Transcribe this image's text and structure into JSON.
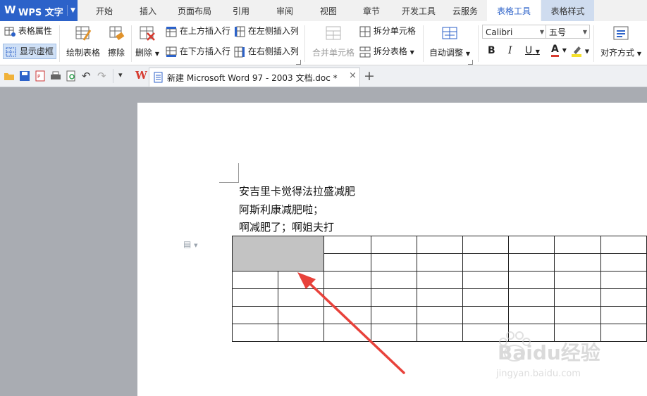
{
  "app": {
    "name": "WPS 文字"
  },
  "menu_tabs": [
    "开始",
    "插入",
    "页面布局",
    "引用",
    "审阅",
    "视图",
    "章节",
    "开发工具",
    "云服务",
    "表格工具",
    "表格样式"
  ],
  "active_tab": "表格工具",
  "ribbon": {
    "table_props": "表格属性",
    "show_grid": "显示虚框",
    "draw_table": "绘制表格",
    "eraser": "擦除",
    "delete": "删除",
    "insert_above": "在上方插入行",
    "insert_below": "在下方插入行",
    "insert_left": "在左侧插入列",
    "insert_right": "在右侧插入列",
    "merge_cells": "合并单元格",
    "split_cells": "拆分单元格",
    "split_table": "拆分表格",
    "auto_fit": "自动调整",
    "font_name": "Calibri",
    "font_size": "五号",
    "bold": "B",
    "italic": "I",
    "underline": "U",
    "font_color_glyph": "A",
    "align": "对齐方式"
  },
  "doc_tab": {
    "title": "新建 Microsoft Word 97 - 2003 文档.doc *"
  },
  "document": {
    "lines": [
      "安吉里卡觉得法拉盛减肥",
      "阿斯利康减肥啦；",
      "啊减肥了；啊姐夫打"
    ]
  },
  "watermark": {
    "brand": "Baidu经验",
    "url": "jingyan.baidu.com"
  },
  "colors": {
    "accent": "#2c62c9",
    "context_tab": "#cfdcef",
    "arrow": "#e8423b",
    "merged_cell": "#c3c3c3"
  }
}
